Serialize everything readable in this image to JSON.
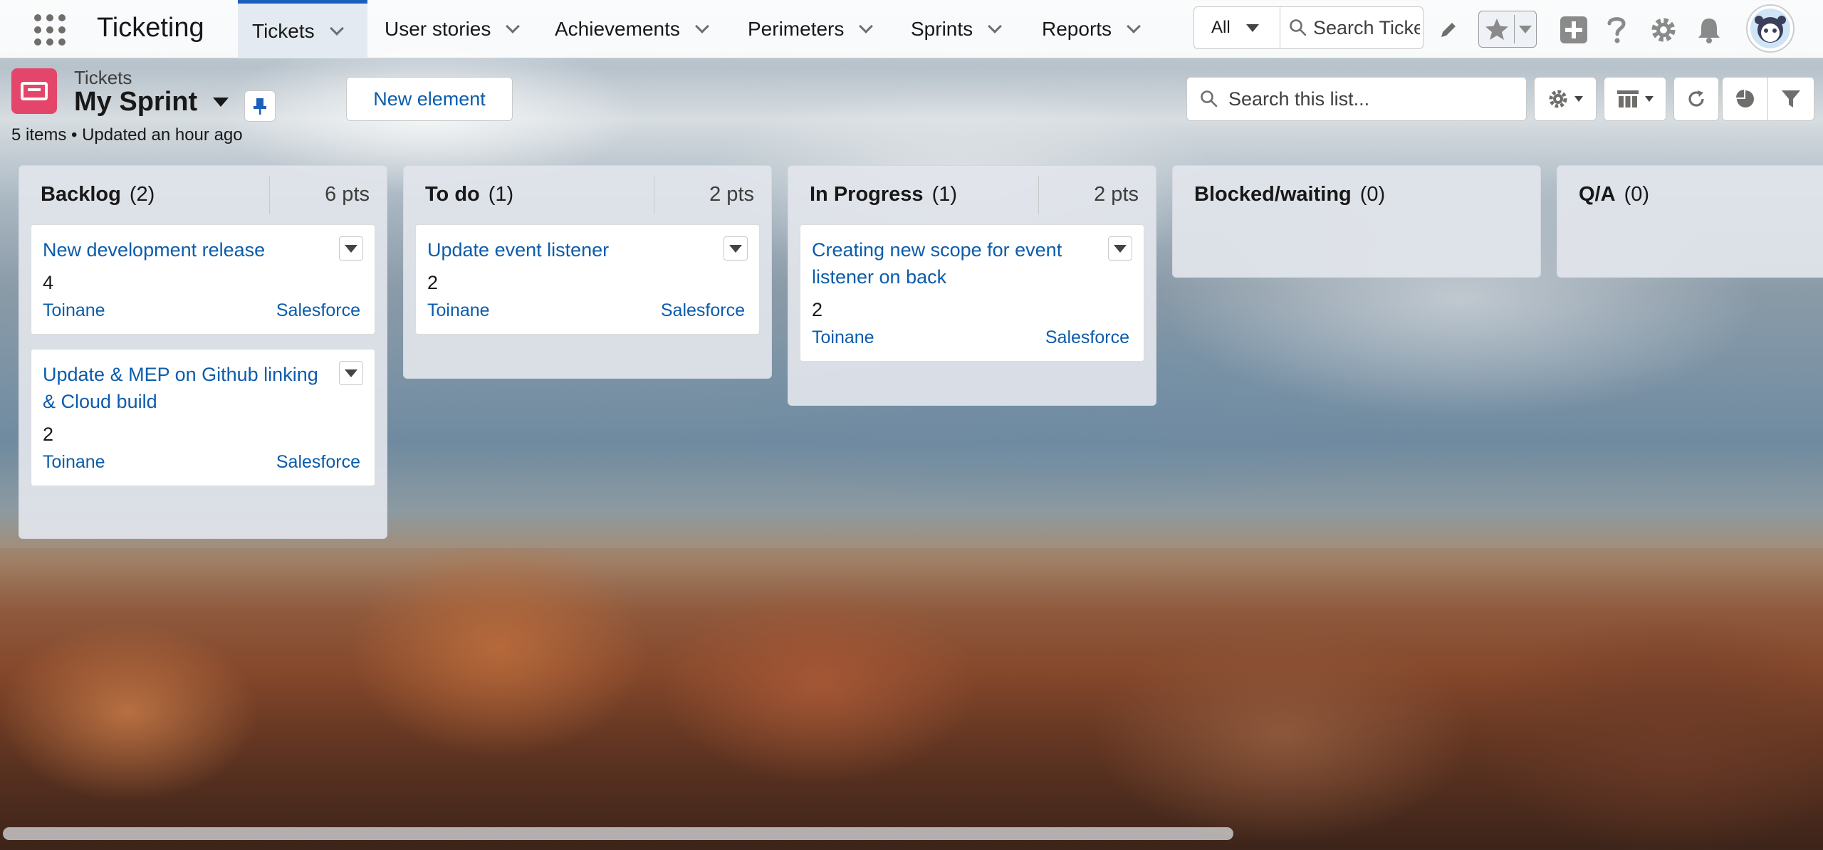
{
  "app": {
    "name": "Ticketing"
  },
  "nav": {
    "tabs": [
      {
        "label": "Tickets"
      },
      {
        "label": "User stories"
      },
      {
        "label": "Achievements"
      },
      {
        "label": "Perimeters"
      },
      {
        "label": "Sprints"
      },
      {
        "label": "Reports"
      }
    ],
    "search_scope": "All",
    "search_placeholder": "Search Tickets and more..."
  },
  "header": {
    "object_label": "Tickets",
    "list_name": "My Sprint",
    "meta": "5 items • Updated an hour ago",
    "new_button": "New  element",
    "list_search_placeholder": "Search this list..."
  },
  "columns": [
    {
      "name": "Backlog",
      "count": "(2)",
      "points": "6 pts",
      "cards": [
        {
          "title": "New development release",
          "points": "4",
          "owner": "Toinane",
          "source": "Salesforce"
        },
        {
          "title": "Update & MEP on Github linking & Cloud build",
          "points": "2",
          "owner": "Toinane",
          "source": "Salesforce"
        }
      ]
    },
    {
      "name": "To do",
      "count": "(1)",
      "points": "2 pts",
      "cards": [
        {
          "title": "Update event listener",
          "points": "2",
          "owner": "Toinane",
          "source": "Salesforce"
        }
      ]
    },
    {
      "name": "In Progress",
      "count": "(1)",
      "points": "2 pts",
      "cards": [
        {
          "title": "Creating new scope for event listener on back",
          "points": "2",
          "owner": "Toinane",
          "source": "Salesforce"
        }
      ]
    },
    {
      "name": "Blocked/waiting",
      "count": "(0)",
      "points": "",
      "cards": []
    },
    {
      "name": "Q/A",
      "count": "(0)",
      "points": "",
      "cards": []
    }
  ],
  "colors": {
    "accent": "#0b5cab",
    "object_icon": "#e3466a",
    "active_tab_bar": "#1b5fbe"
  }
}
